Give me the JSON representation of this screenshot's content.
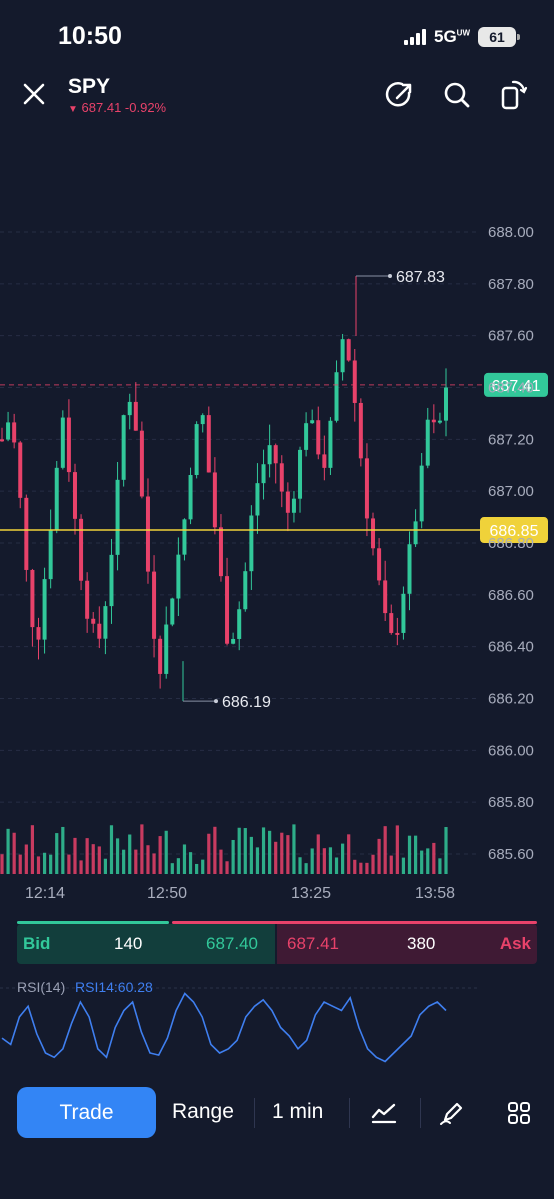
{
  "status": {
    "time": "10:50",
    "network": "5G",
    "network_sup": "UW",
    "battery": "61"
  },
  "header": {
    "symbol": "SPY",
    "arrow": "▼",
    "price": "687.41",
    "change": "-0.92%"
  },
  "colors": {
    "up": "#32c89a",
    "down": "#e8426a",
    "accent": "#3385f5",
    "last_price": "#32c89a",
    "hline": "#f0d23a",
    "rsi": "#3f7ff0",
    "background": "#141a2c"
  },
  "chart": {
    "price_axis": [
      "688.00",
      "687.80",
      "687.60",
      "687.40",
      "687.20",
      "687.00",
      "686.80",
      "686.60",
      "686.40",
      "686.20",
      "686.00",
      "685.80",
      "685.60"
    ],
    "time_axis": [
      "12:14",
      "12:50",
      "13:25",
      "13:58"
    ],
    "last_price_tag": "687.41",
    "hline_tag": "686.85",
    "high_label": "687.83",
    "low_label": "686.19"
  },
  "chart_data": {
    "type": "candlestick",
    "title": "SPY",
    "ylim": [
      685.55,
      688.05
    ],
    "y_ticks": [
      688.0,
      687.8,
      687.6,
      687.4,
      687.2,
      687.0,
      686.8,
      686.6,
      686.4,
      686.2,
      686.0,
      685.8,
      685.6
    ],
    "x_ticks": [
      "12:14",
      "12:50",
      "13:25",
      "13:58"
    ],
    "high": 687.83,
    "low": 686.19,
    "last_price": 687.41,
    "horizontal_line": 686.85,
    "close_path": [
      687.2,
      687.3,
      687.0,
      686.6,
      686.4,
      686.7,
      687.0,
      687.3,
      687.0,
      686.7,
      686.5,
      686.4,
      686.6,
      686.9,
      687.3,
      687.4,
      687.0,
      686.6,
      686.3,
      686.5,
      686.7,
      686.9,
      687.2,
      687.3,
      687.0,
      686.7,
      686.4,
      686.5,
      686.7,
      687.0,
      687.1,
      687.2,
      687.0,
      686.9,
      687.1,
      687.3,
      687.2,
      687.1,
      687.3,
      687.6,
      687.5,
      687.2,
      686.9,
      686.7,
      686.5,
      686.4,
      686.6,
      686.8,
      687.0,
      687.3,
      687.2,
      687.41
    ],
    "volume_note": "volume bars below price"
  },
  "bidask": {
    "bid_label": "Bid",
    "bid_size": "140",
    "bid_price": "687.40",
    "ask_price": "687.41",
    "ask_size": "380",
    "ask_label": "Ask"
  },
  "rsi": {
    "label": "RSI(14)",
    "value_label": "RSI14:60.28",
    "values": [
      45,
      42,
      55,
      60,
      47,
      38,
      36,
      40,
      52,
      62,
      55,
      40,
      36,
      50,
      58,
      62,
      48,
      38,
      37,
      45,
      58,
      66,
      62,
      55,
      42,
      38,
      40,
      44,
      55,
      60,
      63,
      58,
      50,
      46,
      40,
      44,
      56,
      62,
      60,
      58,
      64,
      50,
      40,
      36,
      34,
      38,
      42,
      46,
      56,
      60,
      62,
      58
    ]
  },
  "bottom_bar": {
    "trade": "Trade",
    "range": "Range",
    "interval": "1 min"
  }
}
